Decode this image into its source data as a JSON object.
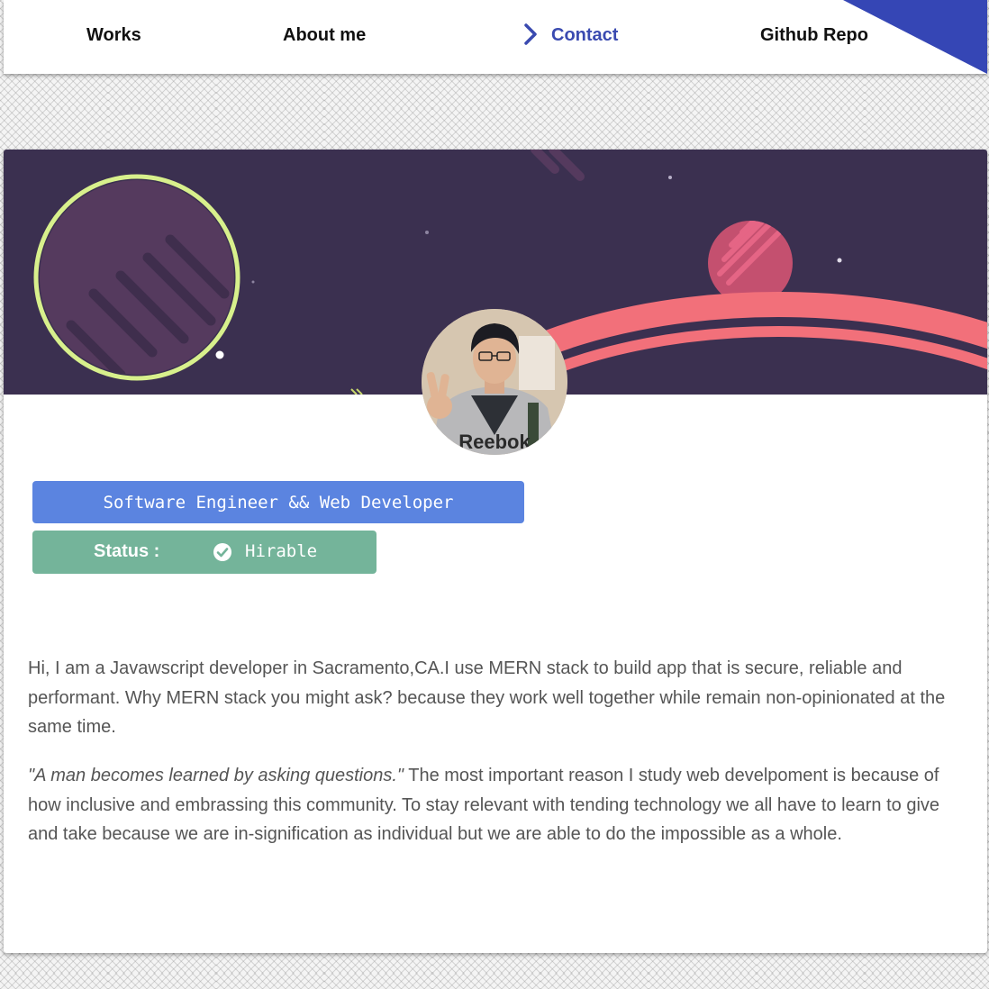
{
  "nav": {
    "items": [
      {
        "label": "Works",
        "active": false
      },
      {
        "label": "About me",
        "active": false
      },
      {
        "label": "Contact",
        "active": true
      },
      {
        "label": "Github Repo",
        "active": false
      }
    ],
    "accent_color": "#3546b5"
  },
  "profile": {
    "title_badge": "Software Engineer && Web Developer",
    "status_label": "Status :",
    "status_value": "Hirable",
    "status_icon": "check-circle-icon",
    "title_badge_color": "#5b84e0",
    "status_badge_color": "#74b49a"
  },
  "bio": {
    "paragraph1": "Hi, I am a Javawscript developer in Sacramento,CA.I use MERN stack to build app that is secure, reliable and performant. Why MERN stack you might ask? because they work well together while remain non-opinionated at the same time.",
    "quote": "\"A man becomes learned by asking questions.\"",
    "paragraph2": " The most important reason I study web develpoment is because of how inclusive and embrassing this community. To stay relevant with tending technology we all have to learn to give and take because we are in-signification as individual but we are able to do the impossible as a whole."
  }
}
